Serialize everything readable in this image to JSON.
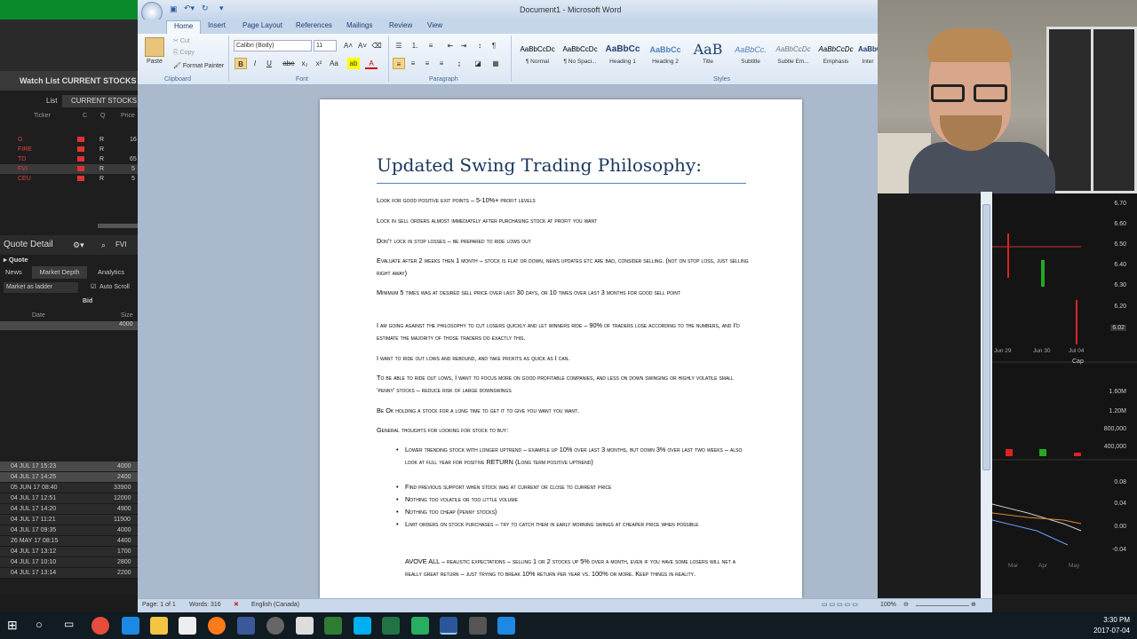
{
  "watchlist": {
    "title": "Watch List CURRENT STOCKS",
    "list_label": "List",
    "list_value": "CURRENT STOCKS",
    "columns": [
      "Ticker",
      "C",
      "Q",
      "Price"
    ],
    "rows": [
      {
        "ticker": "G",
        "q": "R",
        "price": "16"
      },
      {
        "ticker": "FIRE",
        "q": "R",
        "price": ""
      },
      {
        "ticker": "TD",
        "q": "R",
        "price": "65"
      },
      {
        "ticker": "FVI",
        "q": "R",
        "price": "5"
      },
      {
        "ticker": "CEU",
        "q": "R",
        "price": "5"
      }
    ]
  },
  "quote_detail": {
    "title": "Quote Detail",
    "symbol": "FVI",
    "section": "Quote",
    "tabs": [
      "News",
      "Market Depth",
      "Analytics"
    ],
    "mode": "Market as ladder",
    "auto_scroll": "Auto Scroll",
    "bid_label": "Bid",
    "columns": [
      "Date",
      "Size"
    ],
    "first_size": "4000",
    "trades": [
      {
        "date": "04 JUL 17 15:23",
        "size": "4000"
      },
      {
        "date": "04 JUL 17 14:25",
        "size": "2400"
      },
      {
        "date": "05 JUN 17 08:40",
        "size": "33900"
      },
      {
        "date": "04 JUL 17 12:51",
        "size": "12000"
      },
      {
        "date": "04 JUL 17 14:20",
        "size": "4900"
      },
      {
        "date": "04 JUL 17 11:21",
        "size": "11500"
      },
      {
        "date": "04 JUL 17 09:35",
        "size": "4000"
      },
      {
        "date": "26 MAY 17 08:15",
        "size": "4400"
      },
      {
        "date": "04 JUL 17 13:12",
        "size": "1700"
      },
      {
        "date": "04 JUL 17 10:10",
        "size": "2800"
      },
      {
        "date": "04 JUL 17 13:14",
        "size": "2200"
      }
    ]
  },
  "chart": {
    "price_ticks": [
      "6.70",
      "6.60",
      "6.50",
      "6.40",
      "6.30",
      "6.20",
      "6.10"
    ],
    "current_price": "6.02",
    "date_labels": [
      "Jun 29",
      "Jun 30",
      "Jul 04"
    ],
    "cap_label": "Cap",
    "volume_ticks": [
      "1.60M",
      "1.20M",
      "800,000",
      "400,000"
    ],
    "osc_ticks": [
      "0.08",
      "0.04",
      "0.00",
      "-0.04"
    ],
    "month_labels": [
      "Mar",
      "Apr",
      "May"
    ]
  },
  "word": {
    "window_title": "Document1 - Microsoft Word",
    "tabs": [
      "Home",
      "Insert",
      "Page Layout",
      "References",
      "Mailings",
      "Review",
      "View"
    ],
    "clipboard": {
      "paste": "Paste",
      "cut": "Cut",
      "copy": "Copy",
      "format_painter": "Format Painter",
      "group": "Clipboard"
    },
    "font": {
      "name": "Calibri (Body)",
      "size": "11",
      "group": "Font"
    },
    "paragraph_group": "Paragraph",
    "styles_group": "Styles",
    "styles": [
      {
        "preview": "AaBbCcDc",
        "name": "¶ Normal"
      },
      {
        "preview": "AaBbCcDc",
        "name": "¶ No Spaci..."
      },
      {
        "preview": "AaBbCc",
        "name": "Heading 1"
      },
      {
        "preview": "AaBbCc",
        "name": "Heading 2"
      },
      {
        "preview": "AaB",
        "name": "Title"
      },
      {
        "preview": "AaBbCc.",
        "name": "Subtitle"
      },
      {
        "preview": "AaBbCcDc",
        "name": "Subtle Em..."
      },
      {
        "preview": "AaBbCcDc",
        "name": "Emphasis"
      },
      {
        "preview": "AaBbCcDc",
        "name": "Inter"
      }
    ],
    "doc": {
      "title": "Updated Swing Trading Philosophy:",
      "paragraphs": [
        "Look for good positive exit points – 5-10%+ profit levels",
        "Lock in sell orders almost immediately after purchasing stock at profit you want",
        "Don’t lock in stop losses – be prepared to ride lows out",
        "Evaluate after 2 weeks then 1 month – stock is flat or down, news updates etc are bad, consider selling. (not on stop loss, just selling right away)",
        "Minimum 5 times was at desired sell price over last 30 days, or 10 times over last 3 months for good sell point",
        "I am going against the philosophy to cut losers quickly and let winners ride – 90% of traders lose according to the numbers, and I’d estimate the majority of those traders do exactly this.",
        "I want to ride out lows and rebound, and take profits as quick as I can.",
        "To be able to ride out lows, I want to focus more on good profitable companies, and less on down swinging or highly volatile small ‘penny’ stocks – reduce risk of large downswings",
        "Be Ok holding a stock for a long time to get it to give you want you want.",
        "General thoughts for looking for stock to buy:"
      ],
      "bullets": [
        "Lower trending stock with longer uptrend – example up 10% over last 3 months, but down 3% over last two weeks – also look at full year for positive RETURN (Long term positive uptrend)",
        "Find previous support when stock was at current or close to current price",
        "Nothing too volatile or too little volume",
        "Nothing too cheap (penny stocks)",
        "Limit orders on stock purchases – try to catch them in early morning swings at cheaper price when possible"
      ],
      "closing": "AVOVE ALL – realistic expectations – selling 1 or 2 stocks up 5% over a month, even if you have some losers will net a really great return – just trying to break 10% return per year vs. 100% or more. Keep things in reality."
    },
    "status": {
      "page": "Page: 1 of 1",
      "words": "Words: 316",
      "language": "English (Canada)",
      "zoom": "100%"
    }
  },
  "taskbar": {
    "time": "3:30 PM",
    "date": "2017-07-04"
  }
}
